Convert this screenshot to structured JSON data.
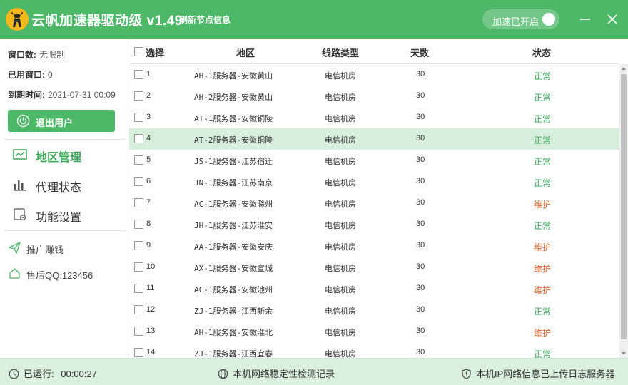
{
  "app": {
    "title": "云帆加速器驱动级 v1.49",
    "refresh_label": "刷新节点信息",
    "accelerate_label": "加速已开启",
    "accelerate_on": true
  },
  "colors": {
    "brand": "#4cb868",
    "status_ok": "#3aa55a",
    "status_maint": "#d9622c",
    "selected_row": "#d8efdd"
  },
  "account": {
    "window_count_label": "窗口数:",
    "window_count_value": "无限制",
    "used_window_label": "已用窗口:",
    "used_window_value": "0",
    "expiry_label": "到期时间:",
    "expiry_value": "2021-07-31 00:09"
  },
  "logout_label": "退出用户",
  "nav": [
    {
      "label": "地区管理",
      "icon": "chart-icon",
      "active": true
    },
    {
      "label": "代理状态",
      "icon": "bar-chart-icon",
      "active": false
    },
    {
      "label": "功能设置",
      "icon": "settings-icon",
      "active": false
    }
  ],
  "links": [
    {
      "label": "推广赚钱",
      "icon": "paper-plane-icon"
    },
    {
      "label": "售后QQ:123456",
      "icon": "home-icon"
    }
  ],
  "table": {
    "headers": {
      "select": "选择",
      "region": "地区",
      "line_type": "线路类型",
      "days": "天数",
      "status": "状态"
    },
    "rows": [
      {
        "id": "1",
        "region": "AH-1服务器-安徽黄山",
        "line": "电信机房",
        "days": "30",
        "status": "正常",
        "kind": "ok"
      },
      {
        "id": "2",
        "region": "AH-2服务器-安徽黄山",
        "line": "电信机房",
        "days": "30",
        "status": "正常",
        "kind": "ok"
      },
      {
        "id": "3",
        "region": "AT-1服务器-安徽铜陵",
        "line": "电信机房",
        "days": "30",
        "status": "正常",
        "kind": "ok"
      },
      {
        "id": "4",
        "region": "AT-2服务器-安徽铜陵",
        "line": "电信机房",
        "days": "30",
        "status": "正常",
        "kind": "ok"
      },
      {
        "id": "5",
        "region": "JS-1服务器-江苏宿迁",
        "line": "电信机房",
        "days": "30",
        "status": "正常",
        "kind": "ok"
      },
      {
        "id": "6",
        "region": "JN-1服务器-江苏南京",
        "line": "电信机房",
        "days": "30",
        "status": "正常",
        "kind": "ok"
      },
      {
        "id": "7",
        "region": "AC-1服务器-安徽滁州",
        "line": "电信机房",
        "days": "30",
        "status": "维护",
        "kind": "maint"
      },
      {
        "id": "8",
        "region": "JH-1服务器-江苏淮安",
        "line": "电信机房",
        "days": "30",
        "status": "正常",
        "kind": "ok"
      },
      {
        "id": "9",
        "region": "AA-1服务器-安徽安庆",
        "line": "电信机房",
        "days": "30",
        "status": "维护",
        "kind": "maint"
      },
      {
        "id": "10",
        "region": "AX-1服务器-安徽宣城",
        "line": "电信机房",
        "days": "30",
        "status": "维护",
        "kind": "maint"
      },
      {
        "id": "11",
        "region": "AC-1服务器-安徽池州",
        "line": "电信机房",
        "days": "30",
        "status": "维护",
        "kind": "maint"
      },
      {
        "id": "12",
        "region": "ZJ-1服务器-江西新余",
        "line": "电信机房",
        "days": "30",
        "status": "正常",
        "kind": "ok"
      },
      {
        "id": "13",
        "region": "AH-1服务器-安徽淮北",
        "line": "电信机房",
        "days": "30",
        "status": "维护",
        "kind": "maint"
      },
      {
        "id": "14",
        "region": "ZJ-1服务器-江西宜春",
        "line": "电信机房",
        "days": "30",
        "status": "正常",
        "kind": "ok"
      }
    ]
  },
  "statusbar": {
    "runtime_label": "已运行:",
    "runtime_value": "00:00:27",
    "network_check": "本机网络稳定性检测记录",
    "ip_log": "本机IP网络信息已上传日志服务器"
  }
}
